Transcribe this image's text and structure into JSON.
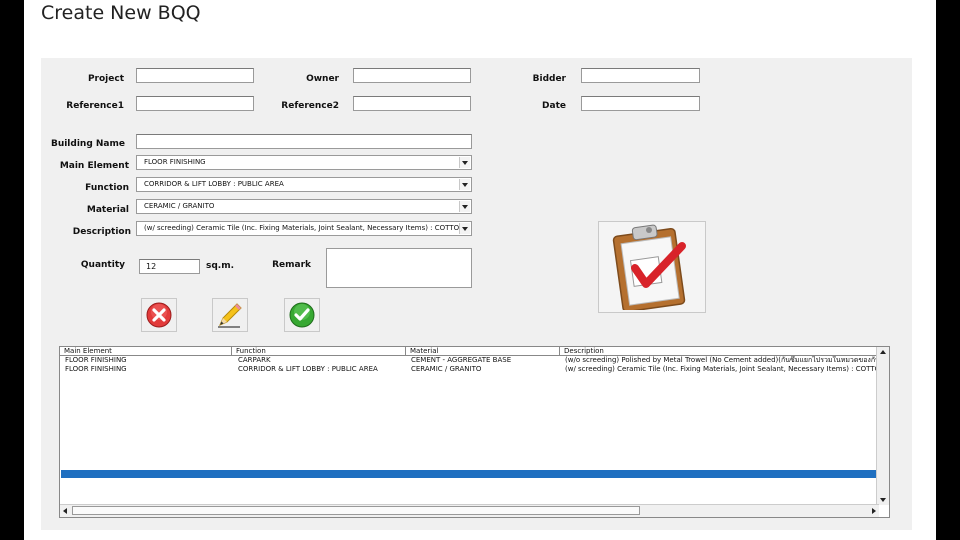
{
  "window": {
    "title": "Create New BQQ"
  },
  "form": {
    "project": {
      "label": "Project",
      "value": ""
    },
    "owner": {
      "label": "Owner",
      "value": ""
    },
    "bidder": {
      "label": "Bidder",
      "value": ""
    },
    "reference1": {
      "label": "Reference1",
      "value": ""
    },
    "reference2": {
      "label": "Reference2",
      "value": ""
    },
    "date": {
      "label": "Date",
      "value": ""
    },
    "building_name": {
      "label": "Building Name",
      "value": ""
    },
    "main_element": {
      "label": "Main Element",
      "value": "FLOOR FINISHING"
    },
    "function": {
      "label": "Function",
      "value": "CORRIDOR & LIFT LOBBY : PUBLIC AREA"
    },
    "material": {
      "label": "Material",
      "value": "CERAMIC / GRANITO"
    },
    "description": {
      "label": "Description",
      "value": "(w/ screeding) Ceramic Tile (Inc. Fixing Materials, Joint Sealant, Necessary Items) : COTTO TRAV"
    },
    "quantity": {
      "label": "Quantity",
      "value": "12",
      "unit": "sq.m."
    },
    "remark": {
      "label": "Remark",
      "value": ""
    }
  },
  "buttons": {
    "delete": {
      "icon": "red-x-icon"
    },
    "edit": {
      "icon": "pencil-icon"
    },
    "confirm": {
      "icon": "green-check-icon"
    },
    "submit": {
      "icon": "clipboard-check-icon"
    }
  },
  "table": {
    "columns": [
      "Main Element",
      "Function",
      "Material",
      "Description"
    ],
    "rows": [
      [
        "FLOOR FINISHING",
        "CARPARK",
        "CEMENT - AGGREGATE BASE",
        "(w/o screeding) Polished by Metal Trowel (No Cement added)(กันซึมแยกไปรวมในหมวดของกันซึ"
      ],
      [
        "FLOOR FINISHING",
        "CORRIDOR & LIFT LOBBY : PUBLIC AREA",
        "CERAMIC / GRANITO",
        "(w/ screeding) Ceramic Tile (Inc. Fixing Materials, Joint Sealant, Necessary Items) : COTTO TRA"
      ]
    ]
  },
  "colors": {
    "selection": "#1f6fc0",
    "panel": "#f0f0f0"
  }
}
